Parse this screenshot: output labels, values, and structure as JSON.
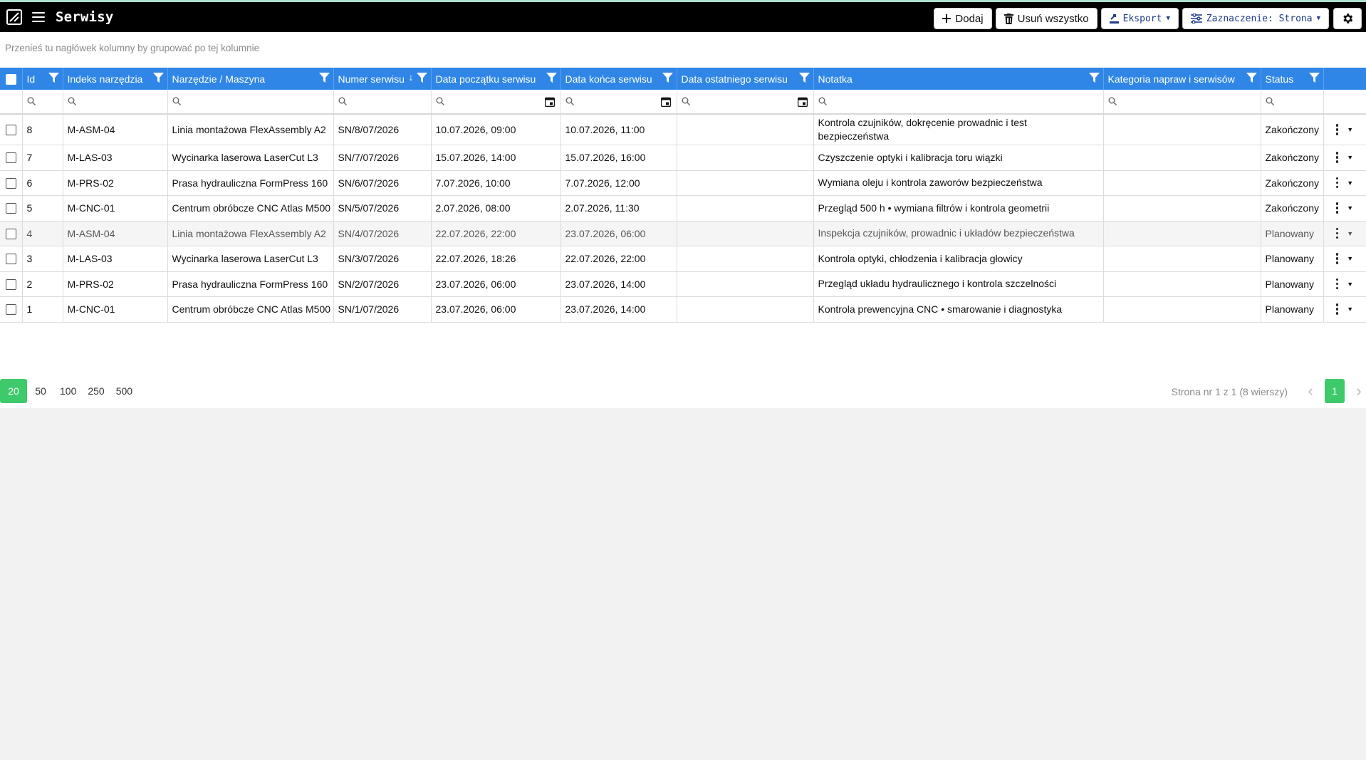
{
  "app": {
    "title": "Serwisy"
  },
  "toolbar": {
    "add_label": "Dodaj",
    "delete_all_label": "Usuń wszystko",
    "export_label": "Eksport",
    "selection_label": "Zaznaczenie: Strona"
  },
  "grid": {
    "group_hint": "Przenieś tu nagłówek kolumny by grupować po tej kolumnie",
    "columns": {
      "id": "Id",
      "tool_index": "Indeks narzędzia",
      "machine": "Narzędzie / Maszyna",
      "service_number": "Numer serwisu",
      "start": "Data początku serwisu",
      "end": "Data końca serwisu",
      "last": "Data ostatniego serwisu",
      "note": "Notatka",
      "category": "Kategoria napraw i serwisów",
      "status": "Status"
    },
    "sorted_column": "service_number",
    "sort_direction": "descending",
    "rows": [
      {
        "id": "8",
        "tool_index": "M-ASM-04",
        "machine": "Linia montażowa FlexAssembly A2",
        "service_number": "SN/8/07/2026",
        "start": "10.07.2026, 09:00",
        "end": "10.07.2026, 11:00",
        "last": "",
        "note": "Kontrola czujników, dokręcenie prowadnic i test bezpieczeństwa",
        "category": "",
        "status": "Zakończony"
      },
      {
        "id": "7",
        "tool_index": "M-LAS-03",
        "machine": "Wycinarka laserowa LaserCut L3",
        "service_number": "SN/7/07/2026",
        "start": "15.07.2026, 14:00",
        "end": "15.07.2026, 16:00",
        "last": "",
        "note": "Czyszczenie optyki i kalibracja toru wiązki",
        "category": "",
        "status": "Zakończony"
      },
      {
        "id": "6",
        "tool_index": "M-PRS-02",
        "machine": "Prasa hydrauliczna FormPress 160",
        "service_number": "SN/6/07/2026",
        "start": "7.07.2026, 10:00",
        "end": "7.07.2026, 12:00",
        "last": "",
        "note": "Wymiana oleju i kontrola zaworów bezpieczeństwa",
        "category": "",
        "status": "Zakończony"
      },
      {
        "id": "5",
        "tool_index": "M-CNC-01",
        "machine": "Centrum obróbcze CNC Atlas M500",
        "service_number": "SN/5/07/2026",
        "start": "2.07.2026, 08:00",
        "end": "2.07.2026, 11:30",
        "last": "",
        "note": "Przegląd 500 h • wymiana filtrów i kontrola geometrii",
        "category": "",
        "status": "Zakończony"
      },
      {
        "id": "4",
        "tool_index": "M-ASM-04",
        "machine": "Linia montażowa FlexAssembly A2",
        "service_number": "SN/4/07/2026",
        "start": "22.07.2026, 22:00",
        "end": "23.07.2026, 06:00",
        "last": "",
        "note": "Inspekcja czujników, prowadnic i układów bezpieczeństwa",
        "category": "",
        "status": "Planowany"
      },
      {
        "id": "3",
        "tool_index": "M-LAS-03",
        "machine": "Wycinarka laserowa LaserCut L3",
        "service_number": "SN/3/07/2026",
        "start": "22.07.2026, 18:26",
        "end": "22.07.2026, 22:00",
        "last": "",
        "note": "Kontrola optyki, chłodzenia i kalibracja głowicy",
        "category": "",
        "status": "Planowany"
      },
      {
        "id": "2",
        "tool_index": "M-PRS-02",
        "machine": "Prasa hydrauliczna FormPress 160",
        "service_number": "SN/2/07/2026",
        "start": "23.07.2026, 06:00",
        "end": "23.07.2026, 14:00",
        "last": "",
        "note": "Przegląd układu hydraulicznego i kontrola szczelności",
        "category": "",
        "status": "Planowany"
      },
      {
        "id": "1",
        "tool_index": "M-CNC-01",
        "machine": "Centrum obróbcze CNC Atlas M500",
        "service_number": "SN/1/07/2026",
        "start": "23.07.2026, 06:00",
        "end": "23.07.2026, 14:00",
        "last": "",
        "note": "Kontrola prewencyjna CNC • smarowanie i diagnostyka",
        "category": "",
        "status": "Planowany"
      }
    ]
  },
  "pager": {
    "page_sizes": [
      "20",
      "50",
      "100",
      "250",
      "500"
    ],
    "active_size": "20",
    "info": "Strona nr 1 z 1 (8 wierszy)",
    "current_page": "1"
  },
  "colors": {
    "header": "#2f86e6",
    "accent": "#3ec96b",
    "topbar": "#000000"
  }
}
